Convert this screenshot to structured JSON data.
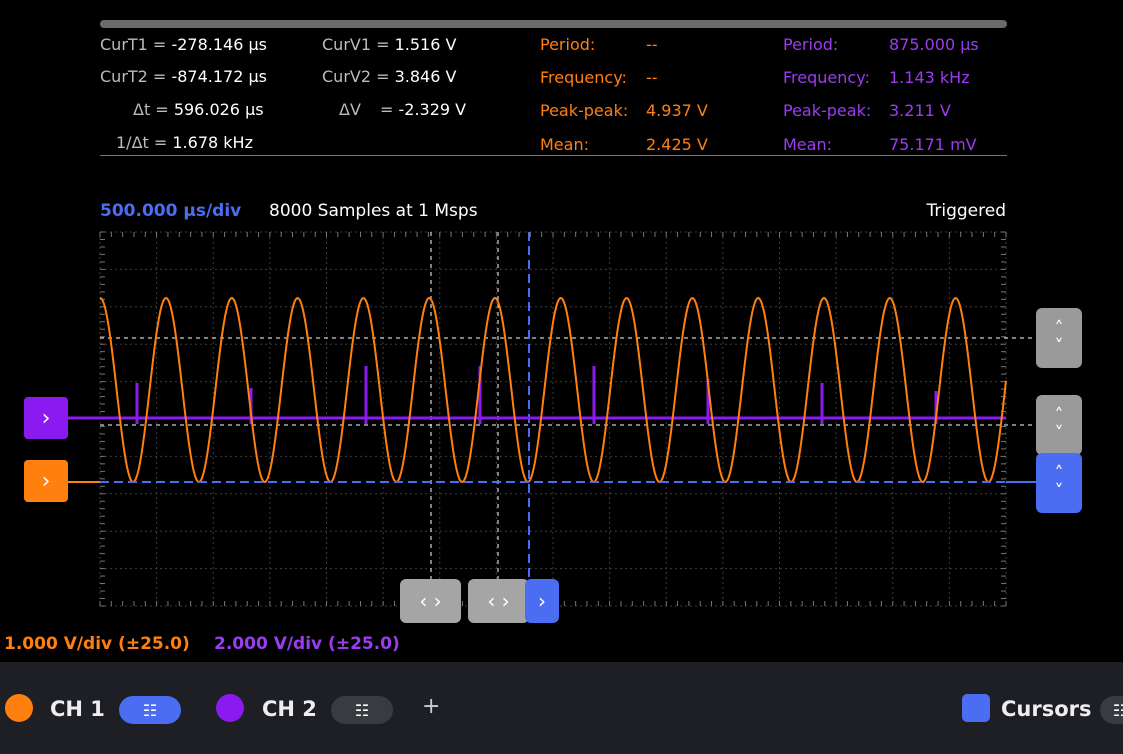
{
  "measurements": {
    "curt1_label": "CurT1 =",
    "curt1": "-278.146 μs",
    "curt2_label": "CurT2 =",
    "curt2": "-874.172 μs",
    "dt_label": "Δt =",
    "dt": "596.026 μs",
    "inv_dt_label": "1/Δt =",
    "inv_dt": "1.678 kHz",
    "curv1_label": "CurV1 =",
    "curv1": "1.516 V",
    "curv2_label": "CurV2 =",
    "curv2": "3.846 V",
    "dv_label": "ΔV",
    "dv_eq": "=",
    "dv": "-2.329 V"
  },
  "ch1_stats": {
    "period_label": "Period:",
    "period": "--",
    "frequency_label": "Frequency:",
    "frequency": "--",
    "peak_label": "Peak-peak:",
    "peak": "4.937 V",
    "mean_label": "Mean:",
    "mean": "2.425 V"
  },
  "ch2_stats": {
    "period_label": "Period:",
    "period": "875.000 μs",
    "frequency_label": "Frequency:",
    "frequency": "1.143 kHz",
    "peak_label": "Peak-peak:",
    "peak": "3.211 V",
    "mean_label": "Mean:",
    "mean": "75.171 mV"
  },
  "timebase": "500.000 μs/div",
  "samples": "8000 Samples at 1 Msps",
  "trigger_status": "Triggered",
  "ch1_scale": "1.000 V/div (±25.0)",
  "ch2_scale": "2.000 V/div (±25.0)",
  "footer": {
    "ch1_label": "CH 1",
    "ch2_label": "CH 2",
    "cursors_label": "Cursors"
  },
  "colors": {
    "ch1": "#ff7f0f",
    "ch2": "#8a1af0",
    "accent": "#4b6df2"
  },
  "icons": {
    "left_handle": "chevron-right-icon",
    "updown": "chevron-up-down-icon",
    "leftright": "chevron-left-right-icon"
  }
}
